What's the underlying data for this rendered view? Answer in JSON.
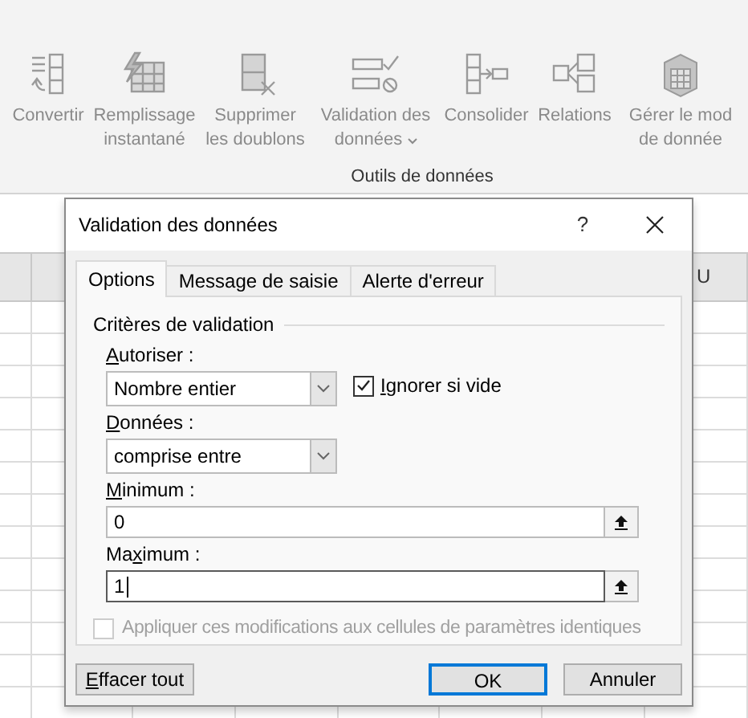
{
  "ribbon": {
    "buttons": [
      {
        "kind": "convert",
        "lines": [
          "Convertir"
        ],
        "dropdown": false
      },
      {
        "kind": "flashfill",
        "lines": [
          "Remplissage",
          "instantané"
        ],
        "dropdown": false
      },
      {
        "kind": "duplicates",
        "lines": [
          "Supprimer",
          "les doublons"
        ],
        "dropdown": false
      },
      {
        "kind": "validation",
        "lines": [
          "Validation des",
          "données"
        ],
        "dropdown": true
      },
      {
        "kind": "consolidate",
        "lines": [
          "Consolider"
        ],
        "dropdown": false
      },
      {
        "kind": "relations",
        "lines": [
          "Relations"
        ],
        "dropdown": false
      },
      {
        "kind": "model",
        "lines": [
          "Gérer le mod",
          "de donnée"
        ],
        "dropdown": false
      }
    ],
    "group_label": "Outils de données"
  },
  "sheet": {
    "column_header": "U"
  },
  "dialog": {
    "title": "Validation des données",
    "help": "?",
    "tabs": [
      {
        "label": "Options",
        "selected": true
      },
      {
        "label": "Message de saisie",
        "selected": false
      },
      {
        "label": "Alerte d'erreur",
        "selected": false
      }
    ],
    "criteria": {
      "title": "Critères de validation",
      "allow": {
        "label": {
          "key": "A",
          "after": "utoriser :"
        },
        "value": "Nombre entier"
      },
      "ignore_blank": {
        "label": {
          "key": "I",
          "after": "gnorer si vide"
        },
        "checked": true
      },
      "data": {
        "label": {
          "key": "D",
          "after": "onnées :"
        },
        "value": "comprise entre"
      },
      "minimum": {
        "label": {
          "key": "M",
          "after": "inimum :"
        },
        "value": "0",
        "focused": false
      },
      "maximum": {
        "label": {
          "before": "Ma",
          "key": "x",
          "after": "imum :"
        },
        "value": "1",
        "focused": true
      }
    },
    "apply_all": {
      "label": "Appliquer ces modifications aux cellules de paramètres identiques",
      "checked": false,
      "disabled": true
    },
    "buttons": [
      {
        "label": {
          "key": "E",
          "after": "ffacer tout"
        },
        "default": false
      },
      {
        "label": "OK",
        "default": true
      },
      {
        "label": "Annuler",
        "default": false
      }
    ]
  }
}
